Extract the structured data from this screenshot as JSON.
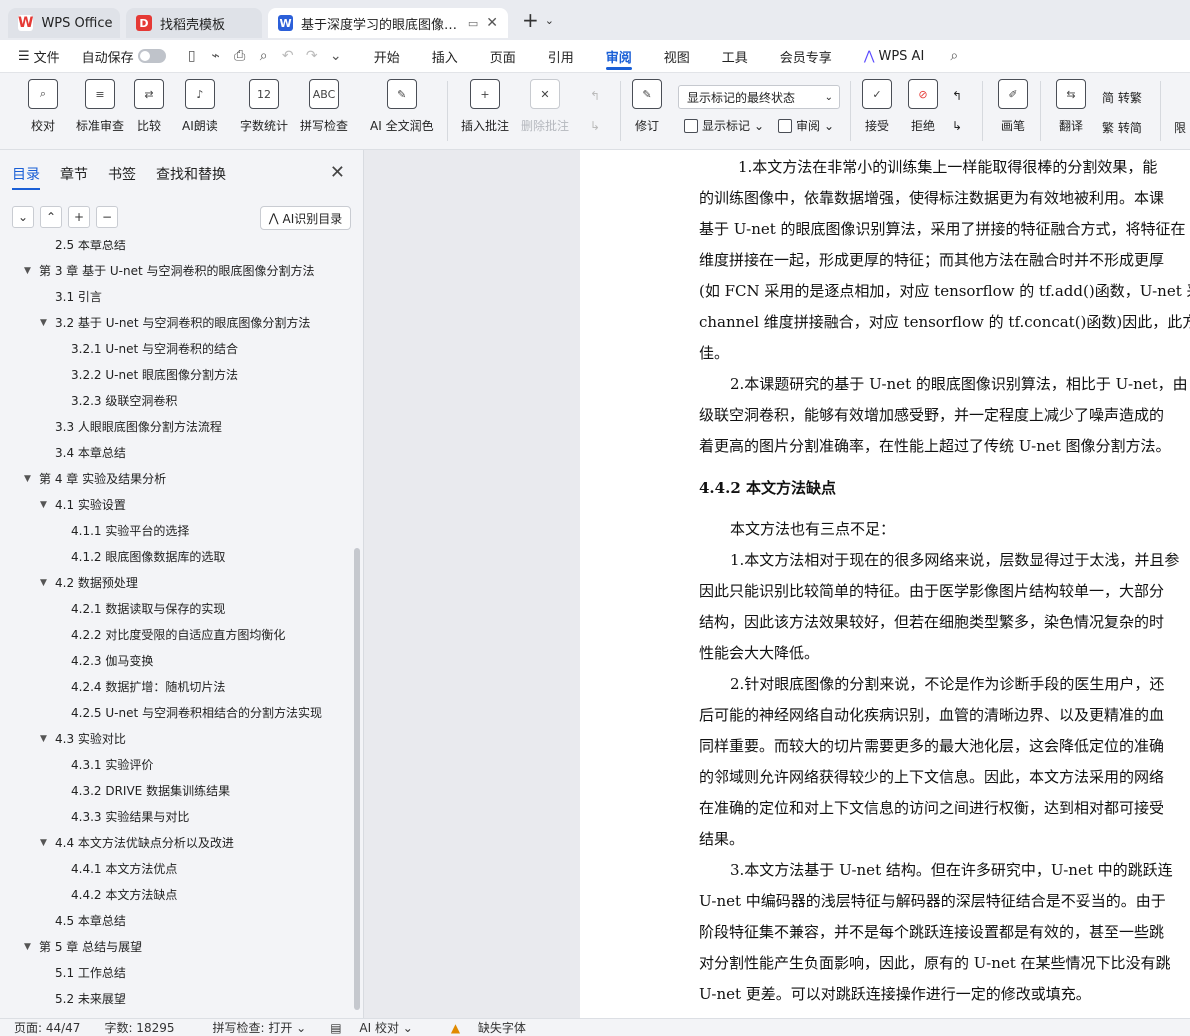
{
  "titlebar": {
    "tabs": [
      {
        "label": "WPS Office"
      },
      {
        "label": "找稻壳模板"
      },
      {
        "label": "基于深度学习的眼底图像分割"
      }
    ]
  },
  "menu": {
    "file": "文件",
    "autosave": "自动保存",
    "tabs": [
      "开始",
      "插入",
      "页面",
      "引用",
      "审阅",
      "视图",
      "工具",
      "会员专享",
      "WPS AI"
    ],
    "active_tab": "审阅"
  },
  "ribbon": {
    "buttons": [
      "校对",
      "标准审查",
      "比较",
      "AI朗读",
      "字数统计",
      "拼写检查",
      "AI 全文润色",
      "插入批注",
      "删除批注",
      "修订",
      "接受",
      "拒绝",
      "画笔",
      "翻译"
    ],
    "display_select": "显示标记的最终状态",
    "show_markup": "显示标记",
    "review": "审阅",
    "to_traditional": "简 转繁",
    "to_simplified": "繁 转简",
    "restrict": "限"
  },
  "panel": {
    "tabs": [
      "目录",
      "章节",
      "书签",
      "查找和替换"
    ],
    "ai_toc": "AI识别目录",
    "toc": [
      {
        "text": "2.5  本章总结",
        "level": 2
      },
      {
        "text": "第 3 章   基于 U-net 与空洞卷积的眼底图像分割方法",
        "level": 1
      },
      {
        "text": "3.1  引言",
        "level": 2
      },
      {
        "text": "3.2  基于 U-net 与空洞卷积的眼底图像分割方法",
        "level": 2
      },
      {
        "text": "3.2.1 U-net 与空洞卷积的结合",
        "level": 3
      },
      {
        "text": "3.2.2 U-net 眼底图像分割方法",
        "level": 3
      },
      {
        "text": "3.2.3  级联空洞卷积",
        "level": 3
      },
      {
        "text": "3.3 人眼眼底图像分割方法流程",
        "level": 2
      },
      {
        "text": "3.4  本章总结",
        "level": 2
      },
      {
        "text": "第 4 章   实验及结果分析",
        "level": 1
      },
      {
        "text": "4.1  实验设置",
        "level": 2
      },
      {
        "text": "4.1.1  实验平台的选择",
        "level": 3
      },
      {
        "text": "4.1.2  眼底图像数据库的选取",
        "level": 3
      },
      {
        "text": "4.2  数据预处理",
        "level": 2
      },
      {
        "text": "4.2.1  数据读取与保存的实现",
        "level": 3
      },
      {
        "text": "4.2.2  对比度受限的自适应直方图均衡化",
        "level": 3
      },
      {
        "text": "4.2.3  伽马变换",
        "level": 3
      },
      {
        "text": "4.2.4  数据扩增：随机切片法",
        "level": 3
      },
      {
        "text": "4.2.5 U-net 与空洞卷积相结合的分割方法实现",
        "level": 3
      },
      {
        "text": "4.3  实验对比",
        "level": 2
      },
      {
        "text": "4.3.1  实验评价",
        "level": 3
      },
      {
        "text": "4.3.2 DRIVE 数据集训练结果",
        "level": 3
      },
      {
        "text": "4.3.3  实验结果与对比",
        "level": 3
      },
      {
        "text": "4.4  本文方法优缺点分析以及改进",
        "level": 2
      },
      {
        "text": "4.4.1  本文方法优点",
        "level": 3
      },
      {
        "text": "4.4.2  本文方法缺点",
        "level": 3
      },
      {
        "text": "4.5  本章总结",
        "level": 2
      },
      {
        "text": "第 5 章   总结与展望",
        "level": 1
      },
      {
        "text": "5.1  工作总结",
        "level": 2
      },
      {
        "text": "5.2  未来展望",
        "level": 2
      }
    ]
  },
  "document": {
    "lines": [
      "1.本文方法在非常小的训练集上一样能取得很棒的分割效果，能",
      "的训练图像中，依靠数据增强，使得标注数据更为有效地被利用。本课",
      "基于 U-net 的眼底图像识别算法，采用了拼接的特征融合方式，将特征在",
      "维度拼接在一起，形成更厚的特征；而其他方法在融合时并不形成更厚",
      "(如 FCN 采用的是逐点相加，对应 tensorflow 的 tf.add()函数，U-net 采",
      "channel 维度拼接融合，对应 tensorflow 的 tf.concat()函数)因此，此方法",
      "佳。",
      "2.本课题研究的基于 U-net 的眼底图像识别算法，相比于 U-net，由",
      "级联空洞卷积，能够有效增加感受野，并一定程度上减少了噪声造成的",
      "着更高的图片分割准确率，在性能上超过了传统 U-net 图像分割方法。",
      "4.4.2  本文方法缺点",
      "本文方法也有三点不足：",
      "1.本文方法相对于现在的很多网络来说，层数显得过于太浅，并且参",
      "因此只能识别比较简单的特征。由于医学影像图片结构较单一，大部分",
      "结构，因此该方法效果较好，但若在细胞类型繁多，染色情况复杂的时",
      "性能会大大降低。",
      "2.针对眼底图像的分割来说，不论是作为诊断手段的医生用户，还",
      "后可能的神经网络自动化疾病识别，血管的清晰边界、以及更精准的血",
      "同样重要。而较大的切片需要更多的最大池化层，这会降低定位的准确",
      "的邻域则允许网络获得较少的上下文信息。因此，本文方法采用的网络",
      "在准确的定位和对上下文信息的访问之间进行权衡，达到相对都可接受",
      "结果。",
      "3.本文方法基于 U-net 结构。但在许多研究中，U-net 中的跳跃连",
      "U-net 中编码器的浅层特征与解码器的深层特征结合是不妥当的。由于",
      "阶段特征集不兼容，并不是每个跳跃连接设置都是有效的，甚至一些跳",
      "对分割性能产生负面影响，因此，原有的 U-net 在某些情况下比没有跳",
      "U-net 更差。可以对跳跃连接操作进行一定的修改或填充。"
    ]
  },
  "status": {
    "page": "页面: 44/47",
    "words": "字数: 18295",
    "spell": "拼写检查: 打开",
    "ai_check": "AI 校对",
    "missing_font": "缺失字体"
  }
}
